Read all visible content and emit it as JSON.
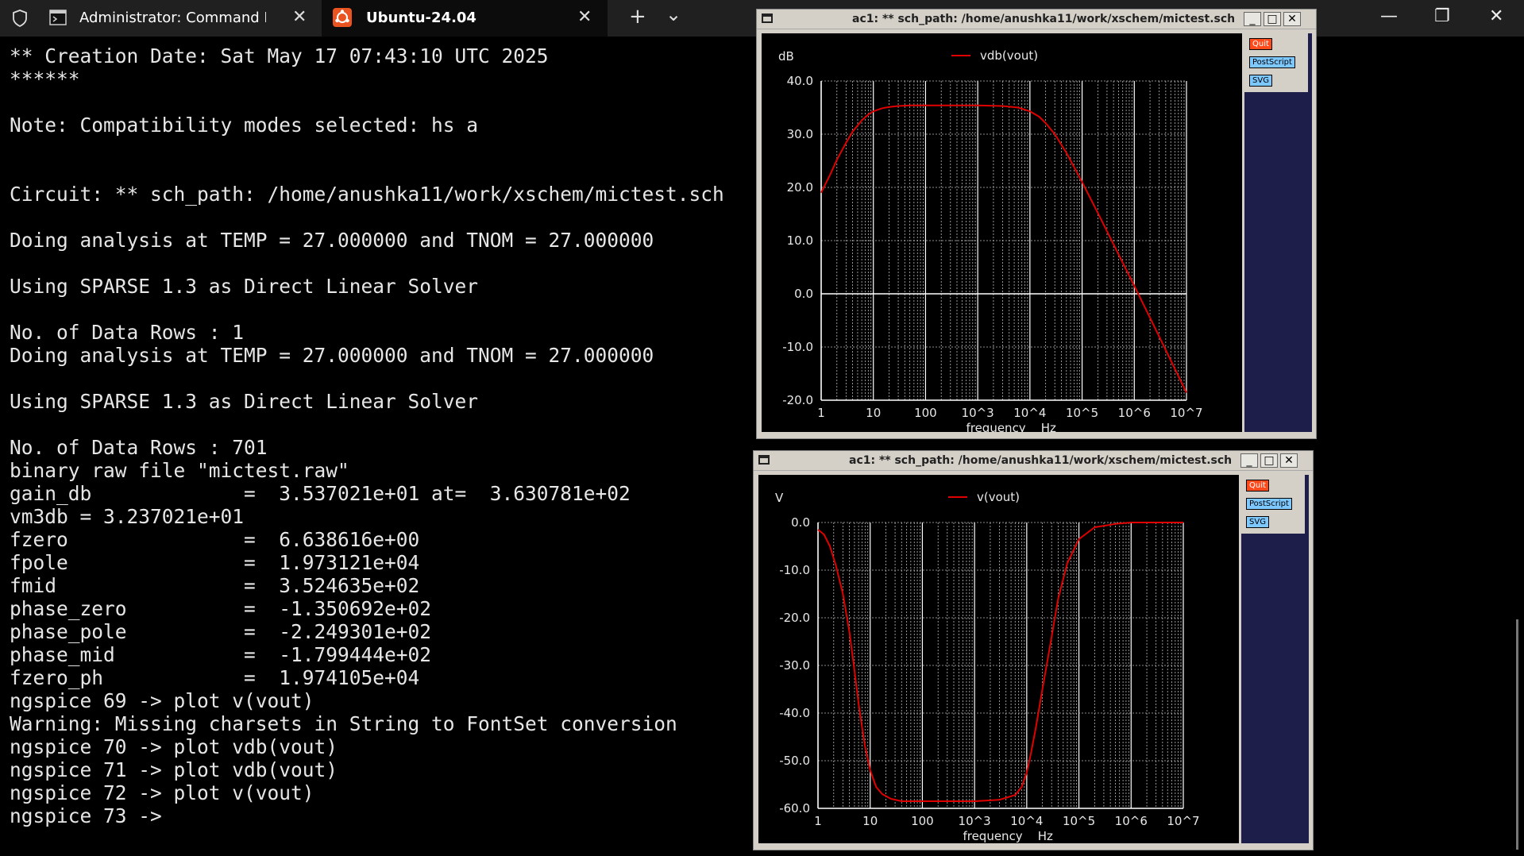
{
  "tabbar": {
    "tabs": [
      {
        "label": "Administrator: Command Pron",
        "active": false
      },
      {
        "label": "Ubuntu-24.04",
        "active": true
      }
    ],
    "new_tab_symbol": "+",
    "dropdown_symbol": "⌄",
    "close_symbol": "✕",
    "window_controls": [
      "—",
      "❐",
      "✕"
    ],
    "shield_icon": "shield-icon",
    "accent_color": "#e95420"
  },
  "terminal": {
    "lines": [
      "** Creation Date: Sat May 17 07:43:10 UTC 2025",
      "******",
      "",
      "Note: Compatibility modes selected: hs a",
      "",
      "",
      "Circuit: ** sch_path: /home/anushka11/work/xschem/mictest.sch",
      "",
      "Doing analysis at TEMP = 27.000000 and TNOM = 27.000000",
      "",
      "Using SPARSE 1.3 as Direct Linear Solver",
      "",
      "No. of Data Rows : 1",
      "Doing analysis at TEMP = 27.000000 and TNOM = 27.000000",
      "",
      "Using SPARSE 1.3 as Direct Linear Solver",
      "",
      "No. of Data Rows : 701",
      "binary raw file \"mictest.raw\"",
      "gain_db             =  3.537021e+01 at=  3.630781e+02",
      "vm3db = 3.237021e+01",
      "fzero               =  6.638616e+00",
      "fpole               =  1.973121e+04",
      "fmid                =  3.524635e+02",
      "phase_zero          =  -1.350692e+02",
      "phase_pole          =  -2.249301e+02",
      "phase_mid           =  -1.799444e+02",
      "fzero_ph            =  1.974105e+04",
      "ngspice 69 -> plot v(vout)",
      "Warning: Missing charsets in String to FontSet conversion",
      "ngspice 70 -> plot vdb(vout)",
      "ngspice 71 -> plot vdb(vout)",
      "ngspice 72 -> plot v(vout)",
      "ngspice 73 ->"
    ]
  },
  "plot_windows": [
    {
      "title": "ac1: ** sch_path: /home/anushka11/work/xschem/mictest.sch",
      "buttons": {
        "quit": "Quit",
        "postscript": "PostScript",
        "svg": "SVG"
      },
      "win_buttons": [
        "_",
        "□",
        "✕"
      ]
    },
    {
      "title": "ac1: ** sch_path: /home/anushka11/work/xschem/mictest.sch",
      "buttons": {
        "quit": "Quit",
        "postscript": "PostScript",
        "svg": "SVG"
      },
      "win_buttons": [
        "_",
        "□",
        "✕"
      ]
    }
  ],
  "chart_data": [
    {
      "type": "line",
      "ylabel": "dB",
      "xlabel": "frequency    Hz",
      "xscale": "log",
      "xlim": [
        1,
        10000000
      ],
      "ylim": [
        -20,
        40
      ],
      "yticks": [
        40,
        30,
        20,
        10,
        0,
        -10,
        -20
      ],
      "ytick_labels": [
        "40.0",
        "30.0",
        "20.0",
        "10.0",
        "0.0",
        "-10.0",
        "-20.0"
      ],
      "xticks": [
        1,
        10,
        100,
        1000,
        10000,
        100000,
        1000000,
        10000000
      ],
      "xtick_labels": [
        "1",
        "10",
        "100",
        "10^3",
        "10^4",
        "10^5",
        "10^6",
        "10^7"
      ],
      "grid": true,
      "series": [
        {
          "name": "vdb(vout)",
          "color": "#e00000",
          "x": [
            1,
            1.5,
            2,
            3,
            4,
            6,
            8,
            10,
            15,
            20,
            30,
            50,
            100,
            300,
            1000,
            3000,
            6000,
            10000,
            15000,
            20000,
            30000,
            50000,
            100000,
            200000,
            500000,
            1000000,
            2000000,
            5000000,
            10000000
          ],
          "y": [
            19,
            22.5,
            25.2,
            28.4,
            30.5,
            32.6,
            33.7,
            34.3,
            34.9,
            35.1,
            35.3,
            35.4,
            35.4,
            35.4,
            35.4,
            35.3,
            35.0,
            34.3,
            33.3,
            32.1,
            30.0,
            26.5,
            21.0,
            15.2,
            7.4,
            1.5,
            -4.5,
            -12.5,
            -18.6
          ]
        }
      ]
    },
    {
      "type": "line",
      "ylabel": "V",
      "xlabel": "frequency    Hz",
      "xscale": "log",
      "xlim": [
        1,
        10000000
      ],
      "ylim": [
        -60,
        0
      ],
      "yticks": [
        0,
        -10,
        -20,
        -30,
        -40,
        -50,
        -60
      ],
      "ytick_labels": [
        "0.0",
        "-10.0",
        "-20.0",
        "-30.0",
        "-40.0",
        "-50.0",
        "-60.0"
      ],
      "xticks": [
        1,
        10,
        100,
        1000,
        10000,
        100000,
        1000000,
        10000000
      ],
      "xtick_labels": [
        "1",
        "10",
        "100",
        "10^3",
        "10^4",
        "10^5",
        "10^6",
        "10^7"
      ],
      "grid": true,
      "series": [
        {
          "name": "v(vout)",
          "color": "#e00000",
          "x": [
            1,
            1.3,
            1.7,
            2.2,
            3,
            4,
            5,
            6,
            7,
            8,
            10,
            13,
            17,
            25,
            40,
            100,
            300,
            1000,
            3000,
            6000,
            8000,
            10000,
            12000,
            15000,
            20000,
            30000,
            40000,
            60000,
            100000,
            200000,
            500000,
            1000000,
            10000000
          ],
          "y": [
            -1.5,
            -2.5,
            -5,
            -9,
            -15,
            -23,
            -31,
            -38,
            -43,
            -47,
            -52,
            -55.5,
            -57,
            -58,
            -58.5,
            -58.5,
            -58.5,
            -58.5,
            -58.2,
            -57.2,
            -55.5,
            -52.5,
            -48.5,
            -43,
            -35,
            -24,
            -16,
            -8.5,
            -3.5,
            -1,
            -0.3,
            0,
            0
          ]
        }
      ]
    }
  ]
}
